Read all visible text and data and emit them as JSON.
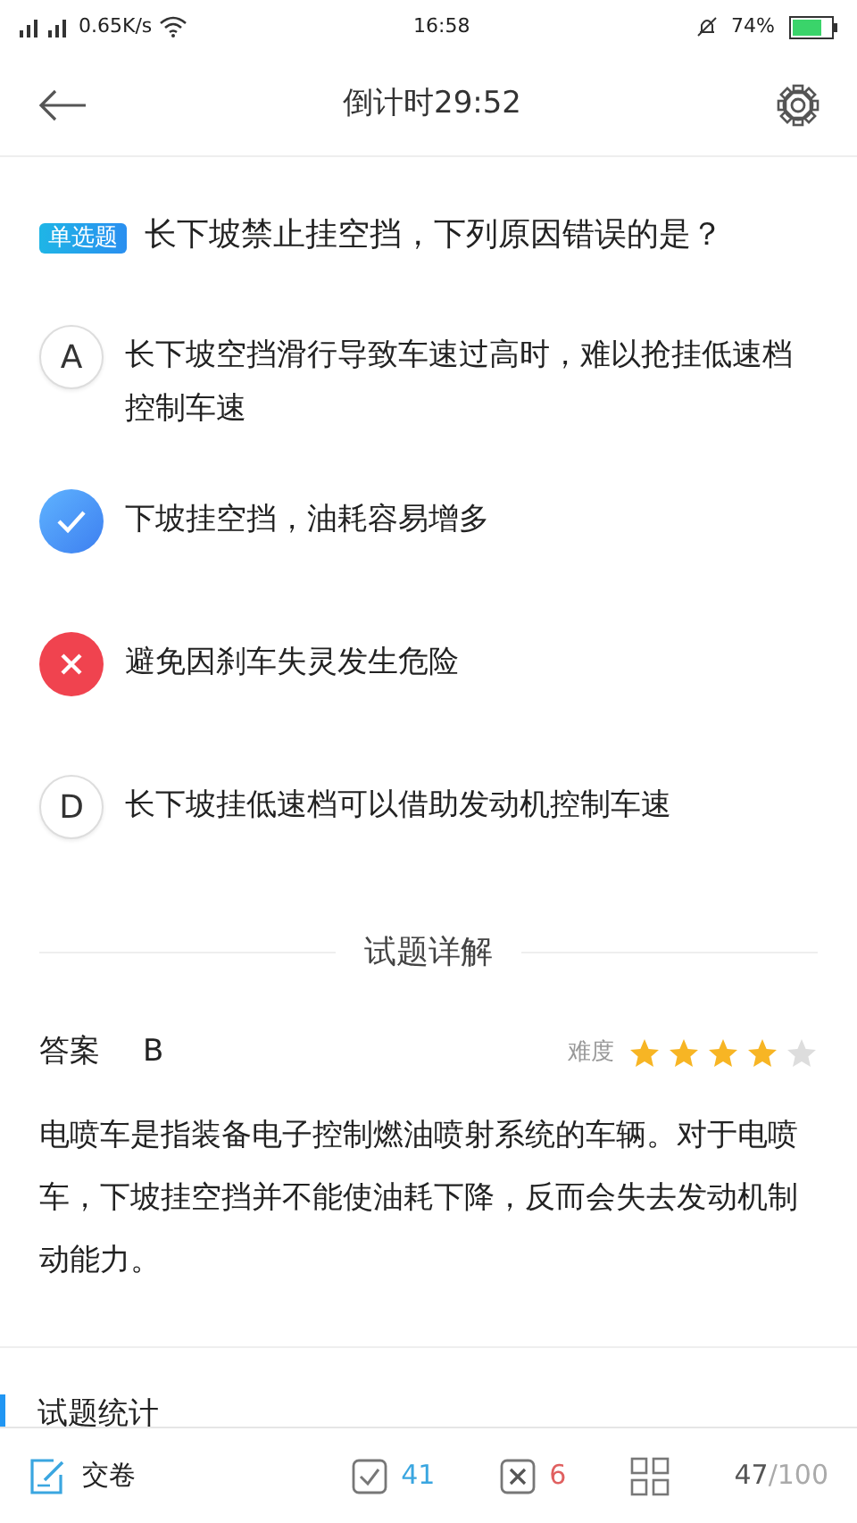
{
  "status_bar": {
    "network_speed": "0.65K/s",
    "time": "16:58",
    "battery_text": "74%"
  },
  "header": {
    "title": "倒计时29:52"
  },
  "question": {
    "type_tag": "单选题",
    "text": "长下坡禁止挂空挡，下列原因错误的是？"
  },
  "options": [
    {
      "kind": "plain",
      "letter": "A",
      "text": "长下坡空挡滑行导致车速过高时，难以抢挂低速档控制车速"
    },
    {
      "kind": "correct",
      "text": "下坡挂空挡，油耗容易增多"
    },
    {
      "kind": "wrong",
      "text": "避免因刹车失灵发生危险"
    },
    {
      "kind": "plain",
      "letter": "D",
      "text": "长下坡挂低速档可以借助发动机控制车速"
    }
  ],
  "explanation": {
    "heading": "试题详解",
    "answer_label": "答案",
    "answer": "B",
    "difficulty_label": "难度",
    "stars": 4,
    "text": "电喷车是指装备电子控制燃油喷射系统的车辆。对于电喷车，下坡挂空挡并不能使油耗下降，反而会失去发动机制动能力。"
  },
  "statistics": {
    "heading": "试题统计"
  },
  "bottom_bar": {
    "submit": "交卷",
    "correct_count": "41",
    "wrong_count": "6",
    "progress": "47",
    "total": "/100"
  }
}
